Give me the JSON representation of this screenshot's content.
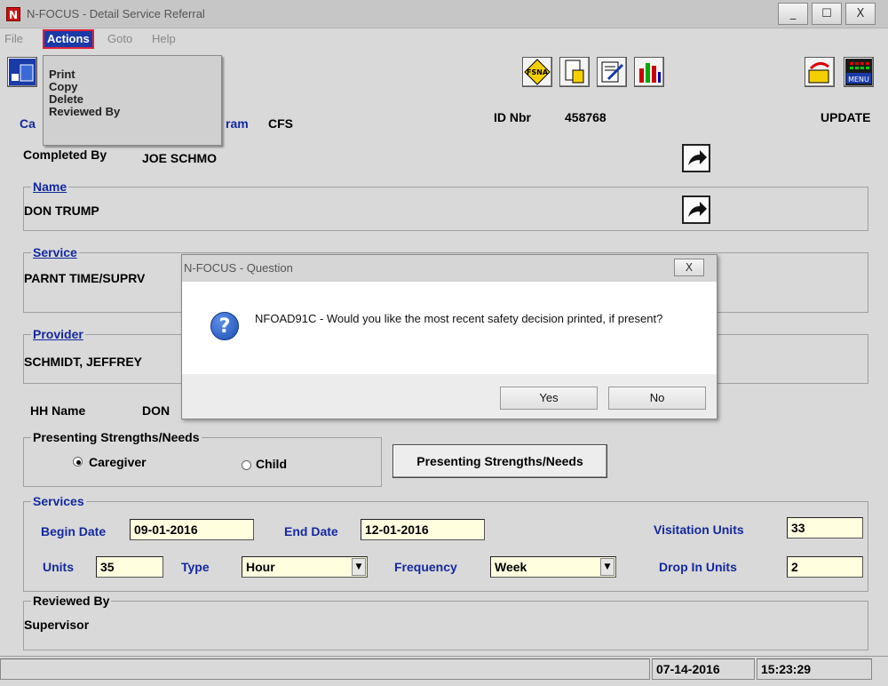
{
  "window": {
    "title": "N-FOCUS - Detail Service Referral",
    "logo_letter": "N",
    "controls": [
      "_",
      "☐",
      "X"
    ]
  },
  "menu": {
    "items": [
      "File",
      "Actions",
      "Goto",
      "Help"
    ],
    "actions_dropdown": [
      "Print",
      "Copy",
      "Delete",
      "Reviewed By"
    ]
  },
  "toolbar": {
    "icons": [
      "calendar-icon",
      "fsna-icon",
      "info-icon",
      "edit-icon",
      "chart-icon",
      "exit-icon",
      "menu-icon"
    ],
    "fsna_label": "FSNA",
    "menu_label": "MENU"
  },
  "form": {
    "case_label_partial": "Ca",
    "program_label_partial": "ram",
    "program_value": "CFS",
    "id_label": "ID Nbr",
    "id_value": "458768",
    "mode": "UPDATE",
    "completed_by_label": "Completed By",
    "completed_by_value": "JOE SCHMO",
    "name_legend": "Name",
    "name_value": "DON TRUMP",
    "service_legend": "Service",
    "service_value": "PARNT TIME/SUPRV",
    "provider_legend": "Provider",
    "provider_value": "SCHMIDT, JEFFREY",
    "hh_name_label": "HH Name",
    "hh_name_value": "DON",
    "strengths_legend": "Presenting Strengths/Needs",
    "radio_caregiver": "Caregiver",
    "radio_child": "Child",
    "strengths_button": "Presenting Strengths/Needs",
    "services_legend": "Services",
    "begin_date_label": "Begin Date",
    "begin_date_value": "09-01-2016",
    "end_date_label": "End Date",
    "end_date_value": "12-01-2016",
    "visitation_units_label": "Visitation Units",
    "visitation_units_value": "33",
    "units_label": "Units",
    "units_value": "35",
    "type_label": "Type",
    "type_value": "Hour",
    "frequency_label": "Frequency",
    "frequency_value": "Week",
    "drop_in_units_label": "Drop In Units",
    "drop_in_units_value": "2",
    "reviewed_by_legend": "Reviewed By",
    "reviewed_by_value": "Supervisor"
  },
  "status": {
    "date": "07-14-2016",
    "time": "15:23:29"
  },
  "dialog": {
    "title": "N-FOCUS - Question",
    "close": "X",
    "icon": "?",
    "message": "NFOAD91C - Would you like the most recent safety decision printed, if present?",
    "yes_label": "Yes",
    "no_label": "No"
  },
  "colors": {
    "label_blue": "#14289e",
    "menu_highlight": "#1a3aa8",
    "menu_outline": "#e0203a",
    "field_bg": "#ffffe0",
    "window_bg": "#d9d9d9"
  }
}
